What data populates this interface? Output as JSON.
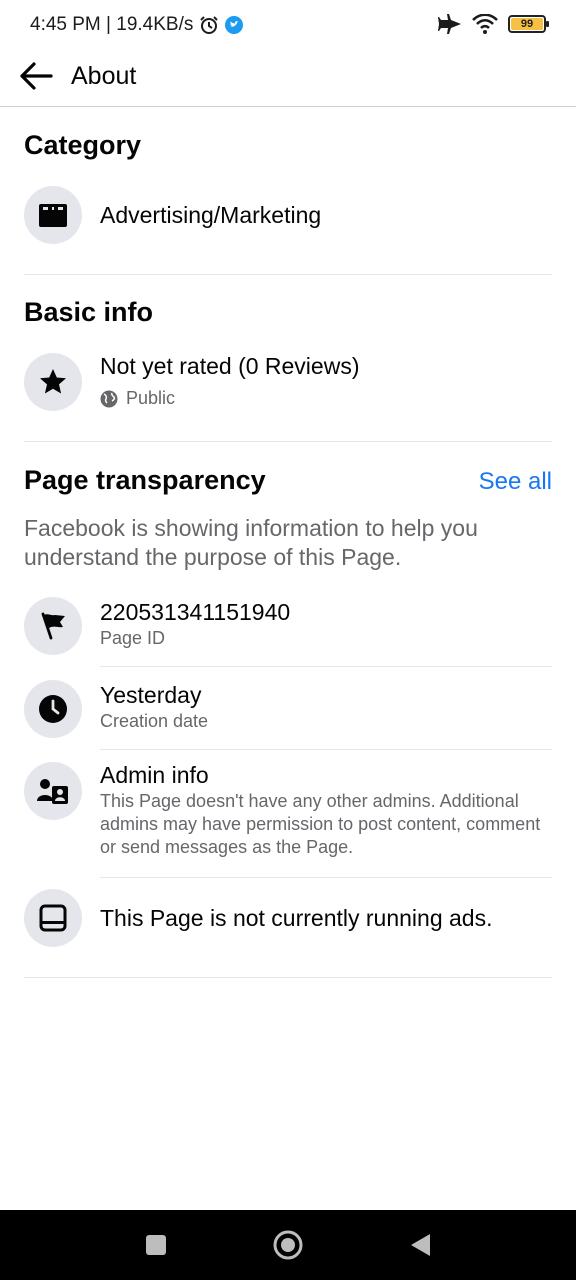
{
  "status_bar": {
    "time_speed": "4:45 PM | 19.4KB/s",
    "battery": "99"
  },
  "header": {
    "title": "About"
  },
  "category": {
    "title": "Category",
    "value": "Advertising/Marketing"
  },
  "basic_info": {
    "title": "Basic info",
    "rating": "Not yet rated (0 Reviews)",
    "visibility": "Public"
  },
  "page_transparency": {
    "title": "Page transparency",
    "see_all": "See all",
    "description": "Facebook is showing information to help you understand the purpose of this Page.",
    "items": [
      {
        "main": "220531341151940",
        "sub": "Page ID"
      },
      {
        "main": "Yesterday",
        "sub": "Creation date"
      },
      {
        "main": "Admin info",
        "sub": "This Page doesn't have any other admins. Additional admins may have permission to post content, comment or send messages as the Page."
      },
      {
        "main": "This Page is not currently running ads."
      }
    ]
  },
  "colors": {
    "accent": "#1877f2",
    "icon_bg": "#e4e6eb",
    "secondary_text": "#65676b"
  }
}
